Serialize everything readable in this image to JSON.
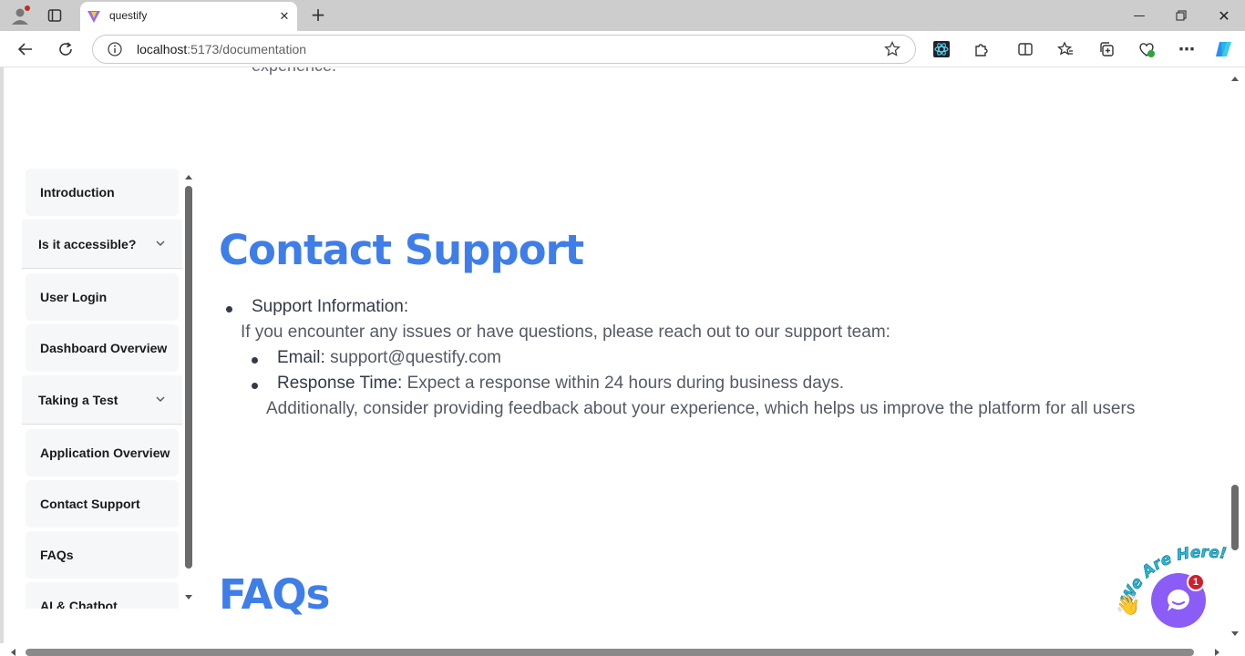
{
  "browser": {
    "tab_title": "questify",
    "url_host": "localhost",
    "url_rest": ":5173/documentation"
  },
  "page": {
    "cut_text": "experience.",
    "sidebar": {
      "items": [
        {
          "label": "Introduction",
          "type": "item"
        },
        {
          "label": "Is it accessible?",
          "type": "accordion"
        },
        {
          "label": "User Login",
          "type": "item"
        },
        {
          "label": "Dashboard Overview",
          "type": "item"
        },
        {
          "label": "Taking a Test",
          "type": "accordion"
        },
        {
          "label": "Application Overview",
          "type": "item"
        },
        {
          "label": "Contact Support",
          "type": "item"
        },
        {
          "label": "FAQs",
          "type": "item"
        },
        {
          "label": "AI & Chatbot",
          "type": "item"
        }
      ]
    },
    "contact": {
      "heading": "Contact Support",
      "support_info_label": "Support Information:",
      "intro": "If you encounter any issues or have questions, please reach out to our support team:",
      "email_label": "Email:",
      "email_value": "support@questify.com",
      "response_label": "Response Time:",
      "response_value": "Expect a response within 24 hours during business days.",
      "additional": "Additionally, consider providing feedback about your experience, which helps us improve the platform for all users"
    },
    "faqs_heading": "FAQs"
  },
  "chat_widget": {
    "banner": "We Are Here!",
    "badge_count": "1"
  },
  "colors": {
    "heading": "#3f7ee8",
    "chat": "#8b5cf6",
    "badge": "#d11f2b"
  }
}
